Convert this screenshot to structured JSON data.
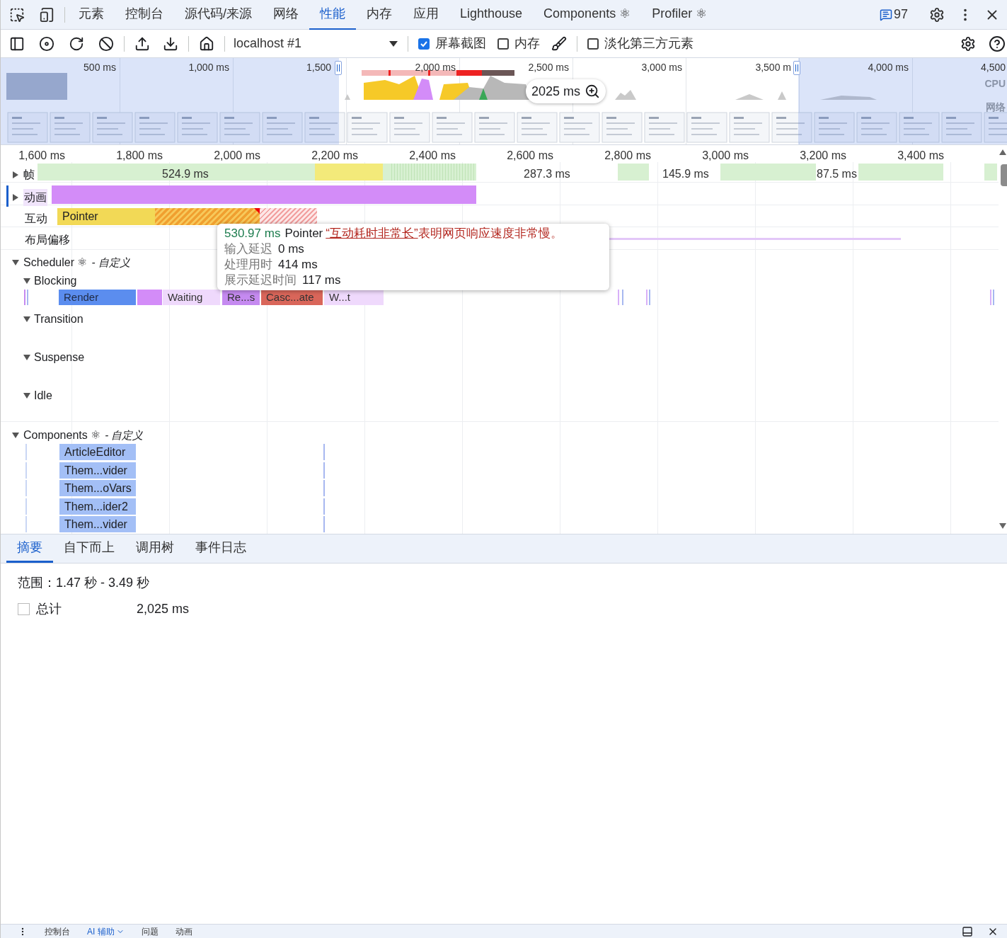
{
  "tabs": [
    {
      "label": "元素",
      "selected": false
    },
    {
      "label": "控制台",
      "selected": false
    },
    {
      "label": "源代码/来源",
      "selected": false
    },
    {
      "label": "网络",
      "selected": false
    },
    {
      "label": "性能",
      "selected": true
    },
    {
      "label": "内存",
      "selected": false
    },
    {
      "label": "应用",
      "selected": false
    },
    {
      "label": "Lighthouse",
      "selected": false
    },
    {
      "label": "Components ⚛",
      "selected": false
    },
    {
      "label": "Profiler ⚛",
      "selected": false
    }
  ],
  "issues_count": "97",
  "toolbar": {
    "recording": "localhost #1",
    "options": [
      {
        "label": "屏幕截图",
        "checked": true
      },
      {
        "label": "内存",
        "checked": false
      }
    ],
    "dim_third_party": {
      "label": "淡化第三方元素",
      "checked": false
    }
  },
  "overview": {
    "ticks": [
      "500 ms",
      "1,000 ms",
      "1,500",
      "2,000 ms",
      "2,500 ms",
      "3,000 ms",
      "3,500 m",
      "4,000 ms",
      "4,500"
    ],
    "selection_badge": "2025 ms",
    "side_labels": [
      "CPU",
      "网络"
    ]
  },
  "ruler": [
    "1,600 ms",
    "1,800 ms",
    "2,000 ms",
    "2,200 ms",
    "2,400 ms",
    "2,600 ms",
    "2,800 ms",
    "3,000 ms",
    "3,200 ms",
    "3,400 ms"
  ],
  "tracks": {
    "frames": {
      "label": "帧",
      "expanded": false,
      "segments": [
        "524.9 ms",
        "287.3 ms",
        "145.9 ms",
        "87.5 ms"
      ]
    },
    "animations": {
      "label": "动画",
      "expanded": false
    },
    "interactions": {
      "label": "互动",
      "event": "Pointer"
    },
    "layout_shifts": {
      "label": "布局偏移"
    },
    "scheduler": {
      "title": "Scheduler ⚛",
      "suffix": "- 自定义",
      "expanded": true,
      "lanes": [
        {
          "name": "Blocking",
          "expanded": true,
          "bars": [
            {
              "label": "Render",
              "kind": "render"
            },
            {
              "label": "Waiting",
              "kind": "waiting"
            },
            {
              "label": "Re...s",
              "kind": "commit"
            },
            {
              "label": "Casc...ate",
              "kind": "cascade"
            },
            {
              "label": "W...t",
              "kind": "waiting"
            }
          ]
        },
        {
          "name": "Transition",
          "expanded": true
        },
        {
          "name": "Suspense",
          "expanded": true
        },
        {
          "name": "Idle",
          "expanded": true
        }
      ]
    },
    "components": {
      "title": "Components ⚛",
      "suffix": "- 自定义",
      "expanded": true,
      "rows": [
        "ArticleEditor",
        "Them...vider",
        "Them...oVars",
        "Them...ider2",
        "Them...vider"
      ]
    }
  },
  "tooltip": {
    "duration": "530.97 ms",
    "event": "Pointer",
    "warning_link": "“互动耗时非常长”",
    "warning_rest": "表明网页响应速度非常慢。",
    "rows": [
      {
        "label": "输入延迟",
        "value": "0 ms"
      },
      {
        "label": "处理用时",
        "value": "414 ms"
      },
      {
        "label": "展示延迟时间",
        "value": "117 ms"
      }
    ]
  },
  "detail_tabs": [
    {
      "label": "摘要",
      "selected": true
    },
    {
      "label": "自下而上",
      "selected": false
    },
    {
      "label": "调用树",
      "selected": false
    },
    {
      "label": "事件日志",
      "selected": false
    }
  ],
  "summary": {
    "range": "范围：1.47 秒 - 3.49 秒",
    "total": {
      "label": "总计",
      "value": "2,025 ms",
      "checked": false
    }
  },
  "drawer_tabs": [
    {
      "label": "控制台",
      "selected": false
    },
    {
      "label": "AI 辅助",
      "selected": true
    },
    {
      "label": "问题",
      "selected": false
    },
    {
      "label": "动画",
      "selected": false
    }
  ]
}
